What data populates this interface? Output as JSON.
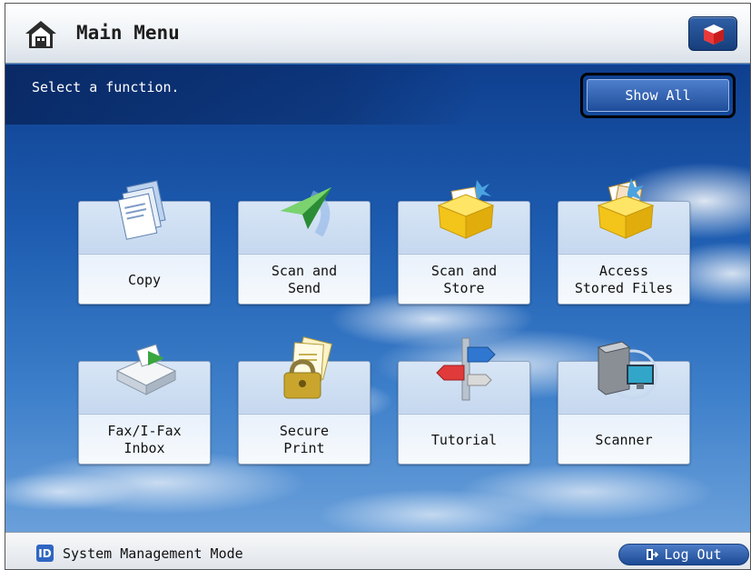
{
  "header": {
    "title": "Main Menu",
    "home_icon": "home-icon",
    "status_icon": "status-monitor-icon"
  },
  "main": {
    "prompt": "Select a function.",
    "show_all_label": "Show All",
    "tiles": [
      {
        "label": "Copy",
        "icon": "copy-icon"
      },
      {
        "label": "Scan and\nSend",
        "icon": "scan-send-icon"
      },
      {
        "label": "Scan and\nStore",
        "icon": "scan-store-icon"
      },
      {
        "label": "Access\nStored Files",
        "icon": "stored-files-icon"
      },
      {
        "label": "Fax/I-Fax\nInbox",
        "icon": "fax-inbox-icon"
      },
      {
        "label": "Secure\nPrint",
        "icon": "secure-print-icon"
      },
      {
        "label": "Tutorial",
        "icon": "tutorial-signpost-icon"
      },
      {
        "label": "Scanner",
        "icon": "scanner-icon"
      }
    ]
  },
  "footer": {
    "id_badge": "ID",
    "mode_text": "System Management Mode",
    "logout_label": "Log Out"
  },
  "colors": {
    "accent": "#1f4d9a",
    "sky_top": "#0f3f8f",
    "sky_bottom": "#6aa0da"
  }
}
